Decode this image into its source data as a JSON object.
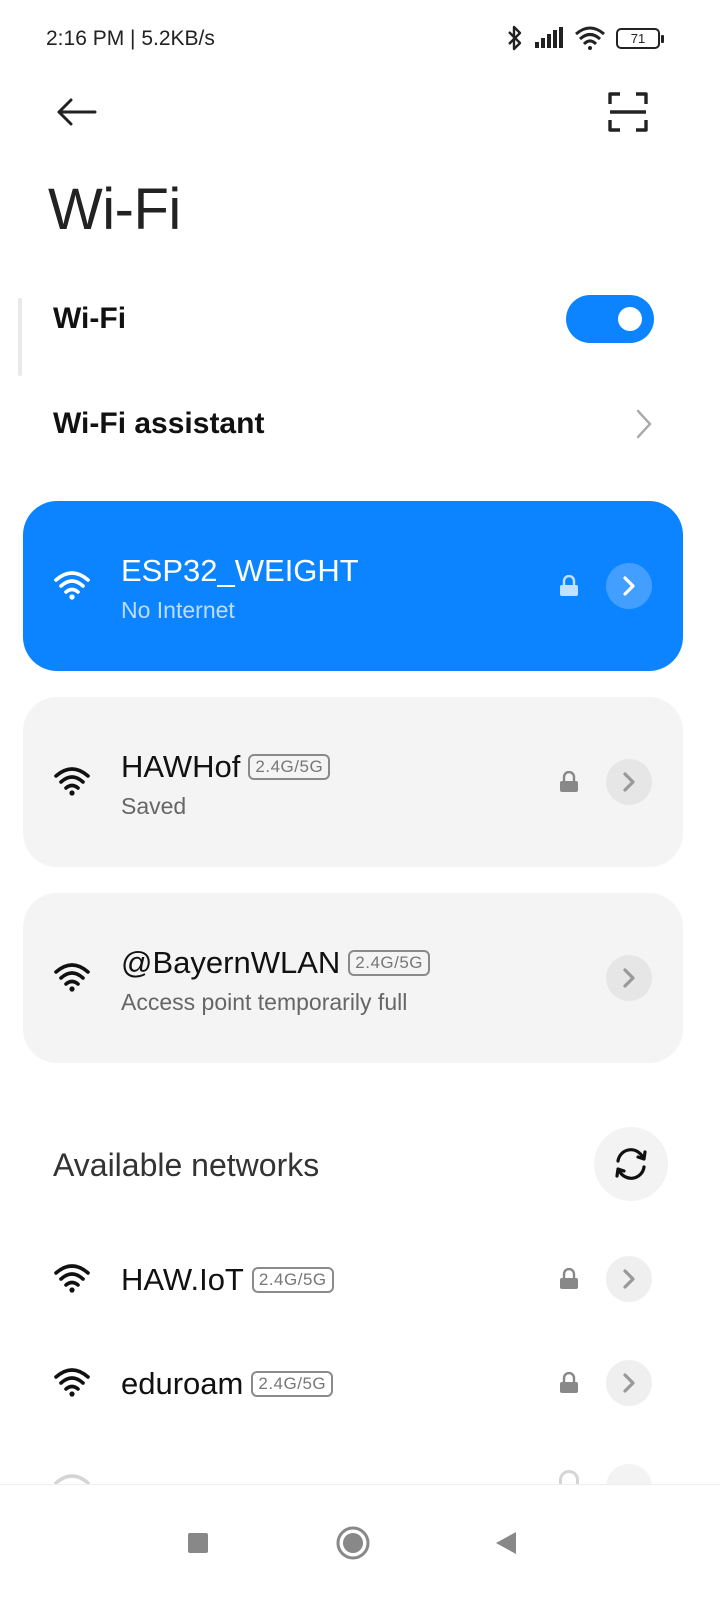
{
  "status_bar": {
    "time": "2:16 PM | 5.2KB/s",
    "battery": "71",
    "icons": [
      "bluetooth-icon",
      "signal-icon",
      "wifi-status-icon",
      "battery-icon"
    ]
  },
  "header": {
    "back_icon": "back-arrow-icon",
    "scan_icon": "scan-qr-icon",
    "title": "Wi-Fi"
  },
  "wifi_toggle": {
    "label": "Wi-Fi",
    "enabled": true
  },
  "assistant": {
    "label": "Wi-Fi assistant"
  },
  "connected_networks": [
    {
      "name": "ESP32_WEIGHT",
      "status": "No Internet",
      "band": "",
      "secured": true,
      "active": true
    },
    {
      "name": "HAWHof",
      "status": "Saved",
      "band": "2.4G/5G",
      "secured": true,
      "active": false
    },
    {
      "name": "@BayernWLAN",
      "status": "Access point temporarily full",
      "band": "2.4G/5G",
      "secured": false,
      "active": false
    }
  ],
  "available": {
    "title": "Available networks",
    "networks": [
      {
        "name": "HAW.IoT",
        "band": "2.4G/5G",
        "secured": true
      },
      {
        "name": "eduroam",
        "band": "2.4G/5G",
        "secured": true
      }
    ]
  },
  "colors": {
    "accent": "#0d84ff",
    "card_bg": "#f4f4f4"
  }
}
